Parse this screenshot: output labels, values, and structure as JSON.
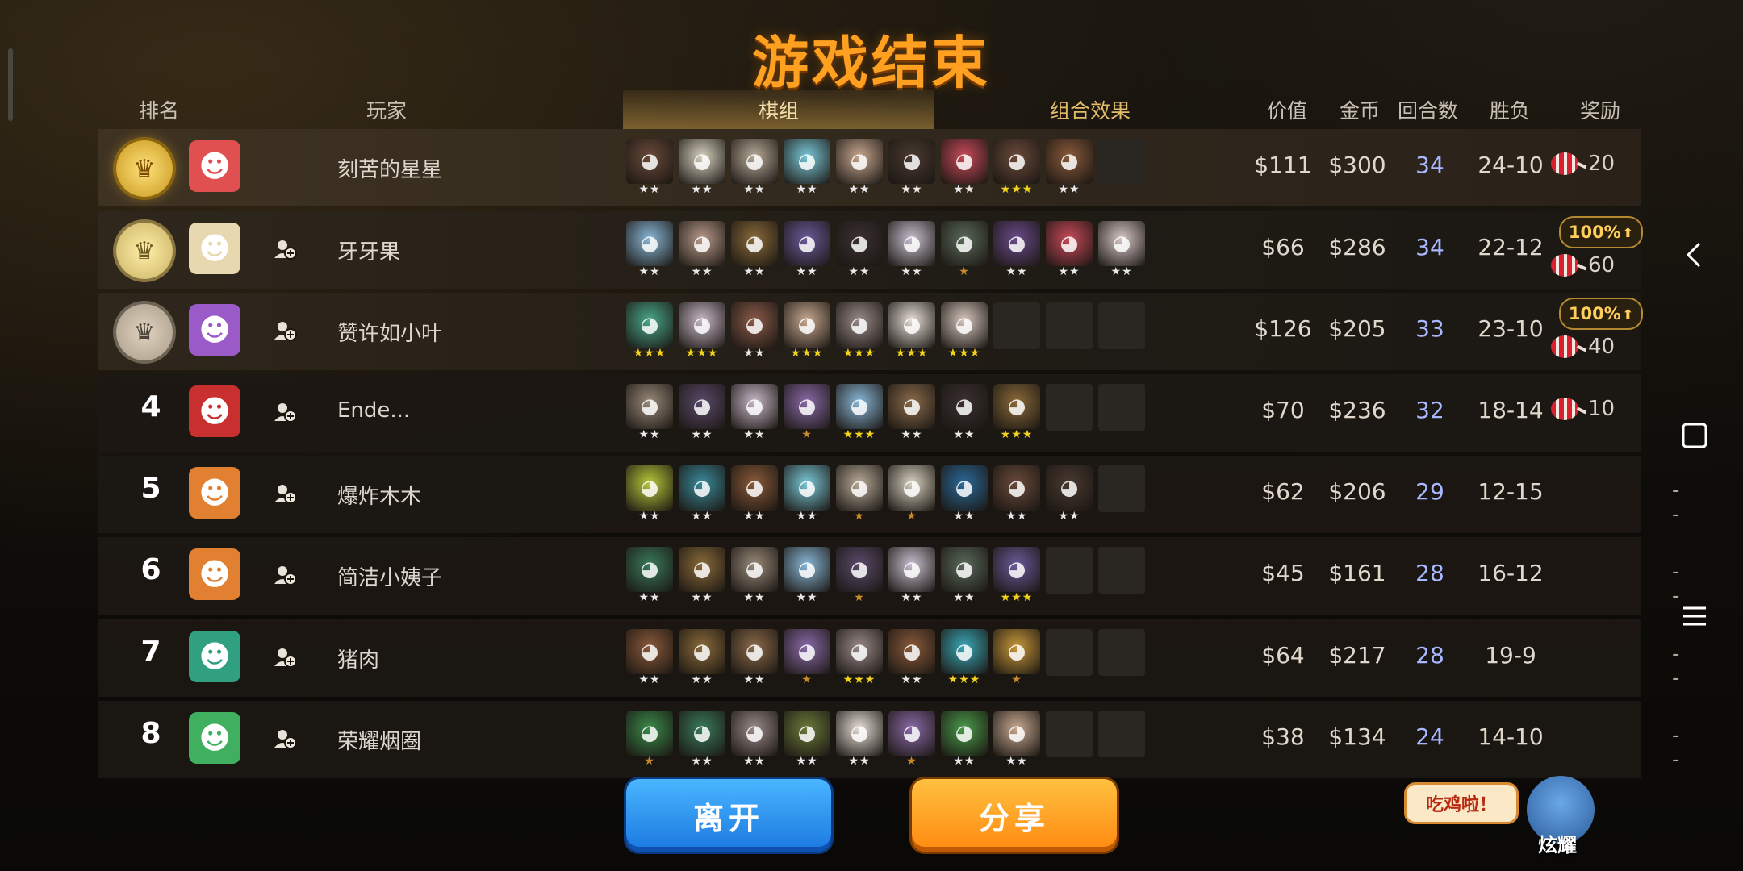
{
  "title": "游戏结束",
  "headers": {
    "rank": "排名",
    "player": "玩家",
    "value": "价值",
    "gold": "金币",
    "rounds": "回合数",
    "winloss": "胜负",
    "reward": "奖励"
  },
  "tabs": [
    {
      "label": "棋组",
      "active": true
    },
    {
      "label": "组合效果",
      "active": false
    }
  ],
  "rows": [
    {
      "rank": "",
      "medal": "gold",
      "name": "刻苦的星星",
      "value": "$111",
      "gold": "$300",
      "rounds": "34",
      "winloss": "24-10",
      "reward": "20",
      "bonus": "",
      "avatarColor": "#e05050",
      "pieces": [
        {
          "c": "#6a4a3a",
          "s": 2
        },
        {
          "c": "#d8d2c0",
          "s": 2
        },
        {
          "c": "#b8aa98",
          "s": 2
        },
        {
          "c": "#7ac8d8",
          "s": 2
        },
        {
          "c": "#c8a890",
          "s": 2
        },
        {
          "c": "#4a3a30",
          "s": 2
        },
        {
          "c": "#c84a5a",
          "s": 2
        },
        {
          "c": "#6a4a3a",
          "s": 3
        },
        {
          "c": "#8a5a3a",
          "s": 2
        },
        {
          "c": "",
          "s": 0
        }
      ]
    },
    {
      "rank": "",
      "medal": "silver",
      "name": "牙牙果",
      "value": "$66",
      "gold": "$286",
      "rounds": "34",
      "winloss": "22-12",
      "reward": "60",
      "bonus": "100%",
      "avatarColor": "#e8d8b0",
      "pieces": [
        {
          "c": "#8ab8d8",
          "s": 2
        },
        {
          "c": "#b89a8a",
          "s": 2
        },
        {
          "c": "#8a6a3a",
          "s": 2
        },
        {
          "c": "#6a5a9a",
          "s": 2
        },
        {
          "c": "#3a3030",
          "s": 2
        },
        {
          "c": "#c8c0d0",
          "s": 2
        },
        {
          "c": "#5a6a5a",
          "s": 1
        },
        {
          "c": "#6a4a8a",
          "s": 2
        },
        {
          "c": "#c84a5a",
          "s": 2
        },
        {
          "c": "#d8c8c8",
          "s": 2
        }
      ]
    },
    {
      "rank": "",
      "medal": "bronze",
      "name": "赞许如小叶",
      "value": "$126",
      "gold": "$205",
      "rounds": "33",
      "winloss": "23-10",
      "reward": "40",
      "bonus": "100%",
      "avatarColor": "#9a5ac8",
      "pieces": [
        {
          "c": "#4aa88a",
          "s": 3
        },
        {
          "c": "#c8b8c8",
          "s": 3
        },
        {
          "c": "#8a5a4a",
          "s": 2
        },
        {
          "c": "#c8a890",
          "s": 3
        },
        {
          "c": "#9a8a8a",
          "s": 3
        },
        {
          "c": "#e8e0d8",
          "s": 3
        },
        {
          "c": "#d8c8c0",
          "s": 3
        },
        {
          "c": "",
          "s": 0
        },
        {
          "c": "",
          "s": 0
        },
        {
          "c": "",
          "s": 0
        }
      ]
    },
    {
      "rank": "4",
      "medal": "",
      "name": "Ende...",
      "value": "$70",
      "gold": "$236",
      "rounds": "32",
      "winloss": "18-14",
      "reward": "10",
      "bonus": "",
      "avatarColor": "#c83030",
      "pieces": [
        {
          "c": "#9a8a7a",
          "s": 2
        },
        {
          "c": "#5a4a6a",
          "s": 2
        },
        {
          "c": "#c8b8c8",
          "s": 2
        },
        {
          "c": "#8a6aa8",
          "s": 1
        },
        {
          "c": "#8ab8d8",
          "s": 3
        },
        {
          "c": "#8a6a4a",
          "s": 2
        },
        {
          "c": "#3a3030",
          "s": 2
        },
        {
          "c": "#8a6a3a",
          "s": 3
        },
        {
          "c": "",
          "s": 0
        },
        {
          "c": "",
          "s": 0
        }
      ]
    },
    {
      "rank": "5",
      "medal": "",
      "name": "爆炸木木",
      "value": "$62",
      "gold": "$206",
      "rounds": "29",
      "winloss": "12-15",
      "reward": "--",
      "bonus": "",
      "avatarColor": "#e08030",
      "pieces": [
        {
          "c": "#b8c83a",
          "s": 2
        },
        {
          "c": "#3a8a9a",
          "s": 2
        },
        {
          "c": "#8a5a3a",
          "s": 2
        },
        {
          "c": "#7ac8d8",
          "s": 2
        },
        {
          "c": "#b8aa98",
          "s": 1
        },
        {
          "c": "#d8d2c0",
          "s": 1
        },
        {
          "c": "#2a6a9a",
          "s": 2
        },
        {
          "c": "#6a4a3a",
          "s": 2
        },
        {
          "c": "#4a3a30",
          "s": 2
        },
        {
          "c": "",
          "s": 0
        }
      ]
    },
    {
      "rank": "6",
      "medal": "",
      "name": "简洁小姨子",
      "value": "$45",
      "gold": "$161",
      "rounds": "28",
      "winloss": "16-12",
      "reward": "--",
      "bonus": "",
      "avatarColor": "#e08030",
      "pieces": [
        {
          "c": "#3a7a5a",
          "s": 2
        },
        {
          "c": "#8a6a3a",
          "s": 2
        },
        {
          "c": "#9a8a7a",
          "s": 2
        },
        {
          "c": "#8ab8d8",
          "s": 2
        },
        {
          "c": "#5a4a6a",
          "s": 1
        },
        {
          "c": "#c8c0d0",
          "s": 2
        },
        {
          "c": "#5a6a5a",
          "s": 2
        },
        {
          "c": "#6a5a9a",
          "s": 3
        },
        {
          "c": "",
          "s": 0
        },
        {
          "c": "",
          "s": 0
        }
      ]
    },
    {
      "rank": "7",
      "medal": "",
      "name": "猪肉",
      "value": "$64",
      "gold": "$217",
      "rounds": "28",
      "winloss": "19-9",
      "reward": "--",
      "bonus": "",
      "avatarColor": "#30a080",
      "pieces": [
        {
          "c": "#8a5a3a",
          "s": 2
        },
        {
          "c": "#8a6a3a",
          "s": 2
        },
        {
          "c": "#8a6a4a",
          "s": 2
        },
        {
          "c": "#8a6aa8",
          "s": 1
        },
        {
          "c": "#9a8a8a",
          "s": 3
        },
        {
          "c": "#8a5a3a",
          "s": 2
        },
        {
          "c": "#3aa8b8",
          "s": 3
        },
        {
          "c": "#c8983a",
          "s": 1
        },
        {
          "c": "",
          "s": 0
        },
        {
          "c": "",
          "s": 0
        }
      ]
    },
    {
      "rank": "8",
      "medal": "",
      "name": "荣耀烟圈",
      "value": "$38",
      "gold": "$134",
      "rounds": "24",
      "winloss": "14-10",
      "reward": "--",
      "bonus": "",
      "avatarColor": "#40b060",
      "pieces": [
        {
          "c": "#3a8a4a",
          "s": 1
        },
        {
          "c": "#3a7a5a",
          "s": 2
        },
        {
          "c": "#9a8a8a",
          "s": 2
        },
        {
          "c": "#6a7a3a",
          "s": 2
        },
        {
          "c": "#e8e0d8",
          "s": 2
        },
        {
          "c": "#8a6aa8",
          "s": 1
        },
        {
          "c": "#4a9a4a",
          "s": 2
        },
        {
          "c": "#c8a890",
          "s": 2
        },
        {
          "c": "",
          "s": 0
        },
        {
          "c": "",
          "s": 0
        }
      ]
    }
  ],
  "buttons": {
    "leave": "离开",
    "share": "分享"
  },
  "mascot": {
    "bubble": "吃鸡啦！",
    "label": "炫耀"
  },
  "colors": {
    "title": "#ffa020",
    "roundsText": "#a8b8ff",
    "leaveBtn": "#2a8ef0",
    "shareBtn": "#ff9a20"
  }
}
